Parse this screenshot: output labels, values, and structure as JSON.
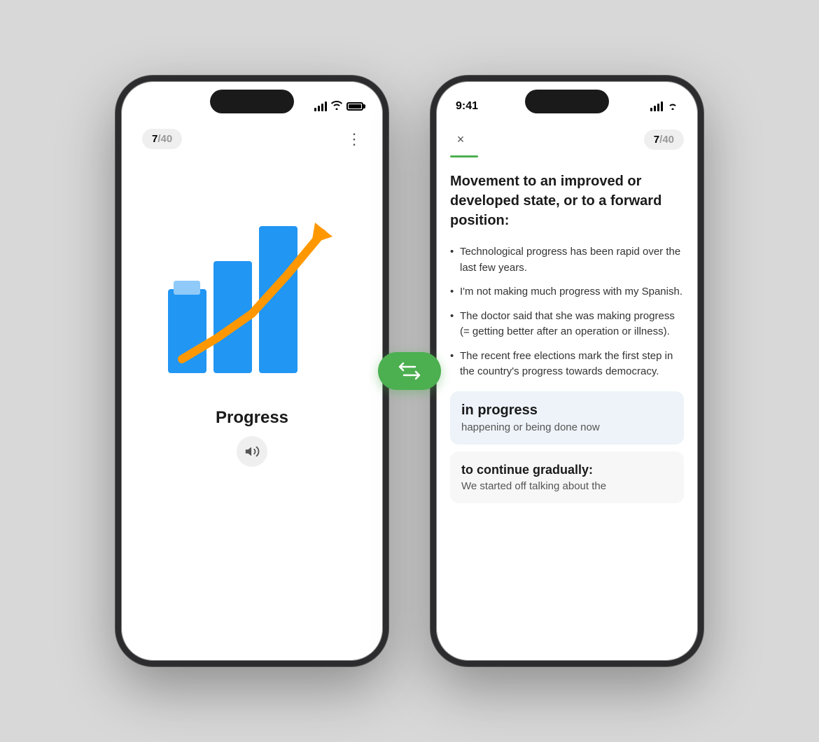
{
  "scene": {
    "background": "#d8d8d8"
  },
  "phone1": {
    "status_bar": {
      "time": "",
      "signal": "signal",
      "wifi": "wifi",
      "battery": "battery"
    },
    "header": {
      "counter": "7/40",
      "counter_current": "7",
      "counter_total": "40",
      "more_icon": "⋮"
    },
    "word": "Progress",
    "sound_icon": "🔊"
  },
  "phone2": {
    "status_bar": {
      "time": "9:41",
      "signal": "signal",
      "wifi": "wifi",
      "battery": "battery"
    },
    "header": {
      "close_icon": "×",
      "counter": "7/40",
      "counter_current": "7",
      "counter_total": "40"
    },
    "definition_main": "Movement to an improved or developed state, or to a forward position:",
    "bullets": [
      "Technological progress has been rapid over the last few years.",
      "I'm not making much progress with my Spanish.",
      "The doctor said that she was making progress (= getting better after an operation or illness).",
      "The recent free elections mark the first step in the country's progress towards democracy."
    ],
    "idiom": {
      "title": "in progress",
      "description": "happening or being done now"
    },
    "secondary": {
      "title": "to continue gradually:",
      "description": "We started off talking about the"
    }
  },
  "swap_button": {
    "icon": "🔄"
  }
}
